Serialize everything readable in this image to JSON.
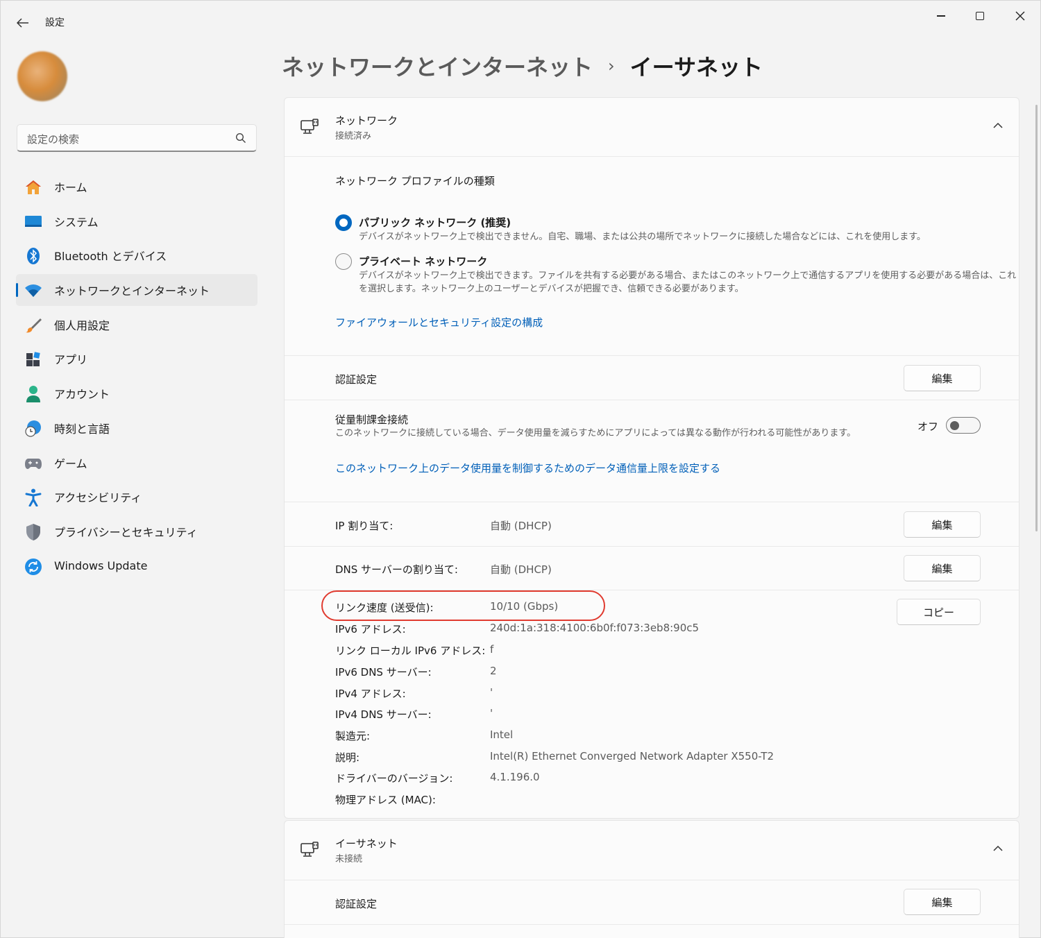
{
  "window": {
    "app_title": "設定"
  },
  "sidebar": {
    "search_placeholder": "設定の検索",
    "items": [
      {
        "label": "ホーム",
        "icon": "home-icon"
      },
      {
        "label": "システム",
        "icon": "system-icon"
      },
      {
        "label": "Bluetooth とデバイス",
        "icon": "bluetooth-icon"
      },
      {
        "label": "ネットワークとインターネット",
        "icon": "wifi-icon",
        "active": true
      },
      {
        "label": "個人用設定",
        "icon": "brush-icon"
      },
      {
        "label": "アプリ",
        "icon": "apps-icon"
      },
      {
        "label": "アカウント",
        "icon": "account-icon"
      },
      {
        "label": "時刻と言語",
        "icon": "time-language-icon"
      },
      {
        "label": "ゲーム",
        "icon": "gamepad-icon"
      },
      {
        "label": "アクセシビリティ",
        "icon": "accessibility-icon"
      },
      {
        "label": "プライバシーとセキュリティ",
        "icon": "shield-icon"
      },
      {
        "label": "Windows Update",
        "icon": "update-icon"
      }
    ]
  },
  "header": {
    "parent": "ネットワークとインターネット",
    "separator": "›",
    "current": "イーサネット"
  },
  "network_card": {
    "title": "ネットワーク",
    "status": "接続済み",
    "profile_heading": "ネットワーク プロファイルの種類",
    "public": {
      "title": "パブリック ネットワーク (推奨)",
      "desc": "デバイスがネットワーク上で検出できません。自宅、職場、または公共の場所でネットワークに接続した場合などには、これを使用します。",
      "selected": true
    },
    "private": {
      "title": "プライベート ネットワーク",
      "desc_line1": "デバイスがネットワーク上で検出できます。ファイルを共有する必要がある場合、またはこのネットワーク上で通信するアプリを使用する必要がある場合は、これ",
      "desc_line2": "を選択します。ネットワーク上のユーザーとデバイスが把握でき、信頼できる必要があります。",
      "selected": false
    },
    "firewall_link": "ファイアウォールとセキュリティ設定の構成",
    "auth_label": "認証設定",
    "edit_label": "編集",
    "metered": {
      "title": "従量制課金接続",
      "desc": "このネットワークに接続している場合、データ使用量を減らすためにアプリによっては異なる動作が行われる可能性があります。",
      "state_label": "オフ",
      "on": false
    },
    "data_limit_link": "このネットワーク上のデータ使用量を制御するためのデータ通信量上限を設定する",
    "ip_assign": {
      "key": "IP 割り当て:",
      "value": "自動 (DHCP)"
    },
    "dns_assign": {
      "key": "DNS サーバーの割り当て:",
      "value": "自動 (DHCP)"
    },
    "copy_label": "コピー",
    "properties": [
      {
        "key": "リンク速度 (送受信):",
        "value": "10/10 (Gbps)"
      },
      {
        "key": "IPv6 アドレス:",
        "value": "240d:1a:318:4100:6b0f:f073:3eb8:90c5"
      },
      {
        "key": "リンク ローカル IPv6 アドレス:",
        "value": "f"
      },
      {
        "key": "IPv6 DNS サーバー:",
        "value": "2"
      },
      {
        "key": "IPv4 アドレス:",
        "value": "'"
      },
      {
        "key": "IPv4 DNS サーバー:",
        "value": "'"
      },
      {
        "key": "製造元:",
        "value": "Intel"
      },
      {
        "key": "説明:",
        "value": "Intel(R) Ethernet Converged Network Adapter X550-T2"
      },
      {
        "key": "ドライバーのバージョン:",
        "value": "4.1.196.0"
      },
      {
        "key": "物理アドレス (MAC):",
        "value": ""
      }
    ]
  },
  "ethernet_card": {
    "title": "イーサネット",
    "status": "未接続",
    "auth_label": "認証設定",
    "edit_label": "編集"
  },
  "colors": {
    "accent": "#0067c0",
    "link": "#005fb8",
    "highlight_circle": "#e03a2f"
  }
}
